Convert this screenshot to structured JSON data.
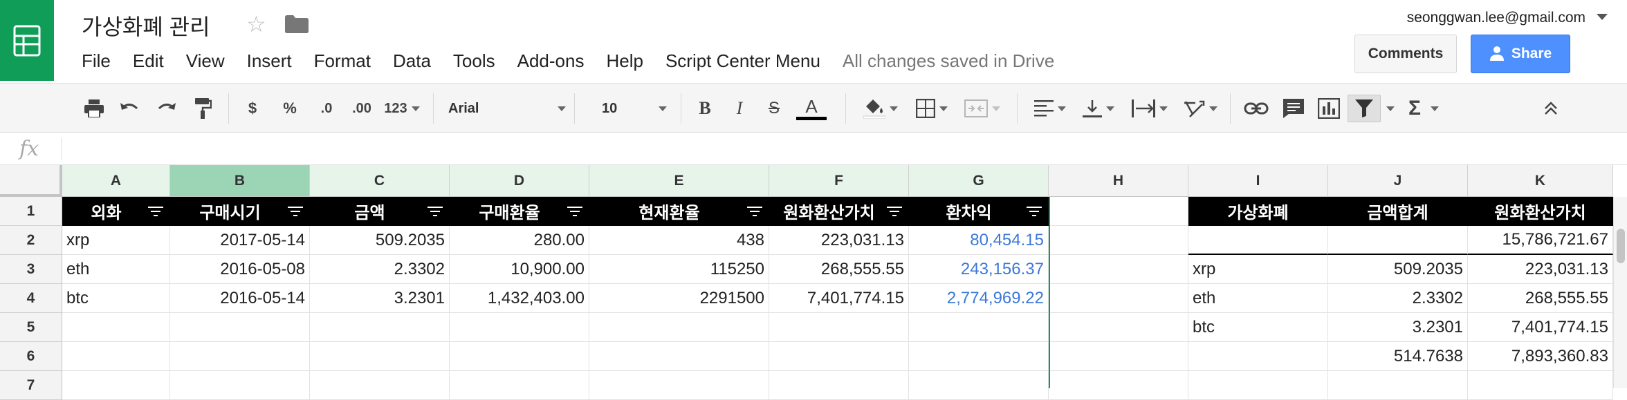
{
  "app": {
    "doc_title": "가상화폐 관리",
    "account_email": "seonggwan.lee@gmail.com",
    "save_status": "All changes saved in Drive",
    "comments_label": "Comments",
    "share_label": "Share",
    "brand_color": "#0f9d58",
    "share_color": "#4d90fe"
  },
  "menu": [
    "File",
    "Edit",
    "View",
    "Insert",
    "Format",
    "Data",
    "Tools",
    "Add-ons",
    "Help",
    "Script Center Menu"
  ],
  "toolbar": {
    "currency": "$",
    "percent": "%",
    "decrease_decimal": ".0",
    "increase_decimal": ".00",
    "more_formats": "123",
    "font": "Arial",
    "font_size": "10",
    "bold": "B",
    "italic": "I",
    "strike": "S",
    "text_color": "A",
    "functions": "Σ",
    "icons": [
      "print-icon",
      "undo-icon",
      "redo-icon",
      "paint-format-icon",
      "fill-color-icon",
      "borders-icon",
      "merge-icon",
      "align-left-icon",
      "valign-bottom-icon",
      "wrap-icon",
      "rotate-icon",
      "link-icon",
      "comment-icon",
      "chart-icon",
      "filter-icon",
      "functions-icon",
      "collapse-icon"
    ]
  },
  "formula_bar": {
    "fx": "fx",
    "value": ""
  },
  "columns": [
    "A",
    "B",
    "C",
    "D",
    "E",
    "F",
    "G",
    "H",
    "I",
    "J",
    "K"
  ],
  "rows": [
    "1",
    "2",
    "3",
    "4",
    "5",
    "6",
    "7"
  ],
  "sheet": {
    "header": [
      "외화",
      "구매시기",
      "금액",
      "구매환율",
      "현재환율",
      "원화환산가치",
      "환차익"
    ],
    "data": [
      [
        "xrp",
        "2017-05-14",
        "509.2035",
        "280.00",
        "438",
        "223,031.13",
        "80,454.15"
      ],
      [
        "eth",
        "2016-05-08",
        "2.3302",
        "10,900.00",
        "115250",
        "268,555.55",
        "243,156.37"
      ],
      [
        "btc",
        "2016-05-14",
        "3.2301",
        "1,432,403.00",
        "2291500",
        "7,401,774.15",
        "2,774,969.22"
      ]
    ],
    "summary_header": [
      "가상화폐",
      "금액합계",
      "원화환산가치"
    ],
    "summary_rows": [
      [
        "",
        "",
        "15,786,721.67"
      ],
      [
        "xrp",
        "509.2035",
        "223,031.13"
      ],
      [
        "eth",
        "2.3302",
        "268,555.55"
      ],
      [
        "btc",
        "3.2301",
        "7,401,774.15"
      ],
      [
        "",
        "514.7638",
        "7,893,360.83"
      ]
    ],
    "profit_color": "#3c78d8"
  }
}
